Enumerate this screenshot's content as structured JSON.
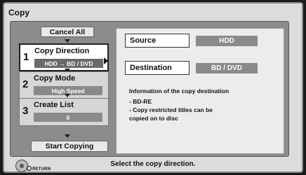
{
  "window": {
    "title": "Copy"
  },
  "left": {
    "cancel_all": "Cancel All",
    "steps": [
      {
        "num": "1",
        "label": "Copy Direction",
        "value": "HDD → BD / DVD",
        "active": true
      },
      {
        "num": "2",
        "label": "Copy Mode",
        "value": "High Speed",
        "active": false
      },
      {
        "num": "3",
        "label": "Create List",
        "value": "0",
        "active": false
      }
    ],
    "start_copying": "Start Copying"
  },
  "right": {
    "source_label": "Source",
    "source_value": "HDD",
    "destination_label": "Destination",
    "destination_value": "BD / DVD",
    "info_lines": [
      "Information of the copy destination",
      "- BD-RE",
      "- Copy restricted titles can be",
      "  copied on to disc"
    ]
  },
  "footer": {
    "return_label": "RETURN",
    "status_text": "Select the copy direction."
  }
}
